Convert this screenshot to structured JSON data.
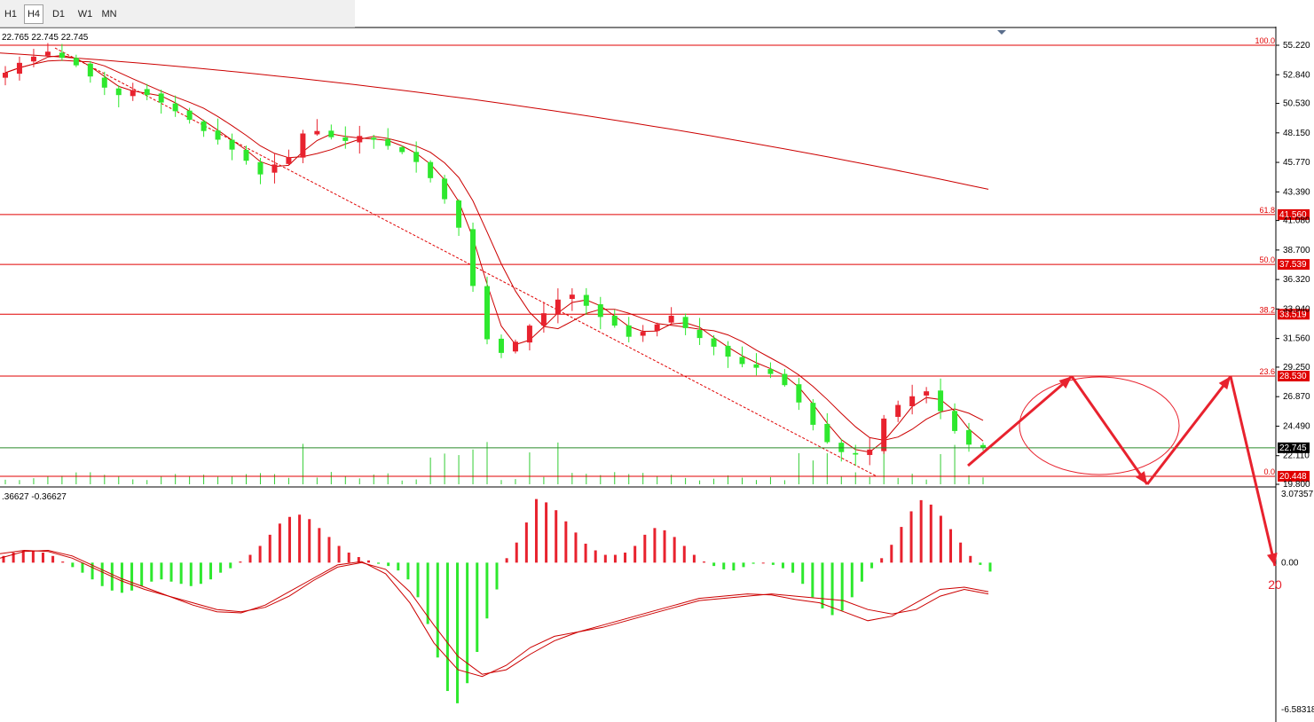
{
  "toolbar": {
    "timeframes": [
      {
        "label": "H1",
        "active": false
      },
      {
        "label": "H4",
        "active": true
      },
      {
        "label": "D1",
        "active": false
      },
      {
        "label": "W1",
        "active": false
      },
      {
        "label": "MN",
        "active": false
      }
    ]
  },
  "ohlc_text": "22.765 22.745 22.745",
  "macd_text": ".36627 -0.36627",
  "target_label": "20",
  "colors": {
    "up": "#e8222e",
    "down": "#2ee82e",
    "fib": "#e00000",
    "ma": "#cc0000",
    "current": "#2a8a2a"
  },
  "chart_data": [
    {
      "type": "candlestick",
      "title": "",
      "price_axis": {
        "ticks": [
          "55.220",
          "52.840",
          "50.530",
          "48.150",
          "45.770",
          "43.390",
          "41.080",
          "38.700",
          "36.320",
          "33.940",
          "31.560",
          "29.250",
          "26.870",
          "24.490",
          "22.110",
          "19.800"
        ],
        "ylim": [
          19.8,
          55.22
        ]
      },
      "fibonacci": [
        {
          "ratio": "100.0",
          "price": "55.220"
        },
        {
          "ratio": "61.8",
          "price": "41.560"
        },
        {
          "ratio": "50.0",
          "price": "37.539"
        },
        {
          "ratio": "38.2",
          "price": "33.519"
        },
        {
          "ratio": "23.6",
          "price": "28.530"
        },
        {
          "ratio": "0.0",
          "price": "20.448"
        }
      ],
      "current_price": "22.745",
      "close_path": [
        53.0,
        53.8,
        54.3,
        54.7,
        54.2,
        53.6,
        52.7,
        51.8,
        51.2,
        51.6,
        51.2,
        50.6,
        49.9,
        49.2,
        48.3,
        47.6,
        46.8,
        45.9,
        44.8,
        45.6,
        46.2,
        48.1,
        48.3,
        47.8,
        47.5,
        47.9,
        47.6,
        47.1,
        46.6,
        45.8,
        44.5,
        42.8,
        40.5,
        35.8,
        31.5,
        30.4,
        31.3,
        32.6,
        33.6,
        34.7,
        35.1,
        34.2,
        33.3,
        32.6,
        31.7,
        32.1,
        32.7,
        33.4,
        32.4,
        31.6,
        30.9,
        30.1,
        29.5,
        29.2,
        28.7,
        27.8,
        26.4,
        24.6,
        23.2,
        22.4,
        22.2,
        22.6,
        25.1,
        26.2,
        26.9,
        27.3,
        25.7,
        24.1,
        23.0,
        22.745
      ],
      "ma_long_start": 54.6,
      "ma_long_end": 43.6,
      "projection": [
        {
          "step": 0,
          "price": 21.3
        },
        {
          "step": 1,
          "price": 28.5
        },
        {
          "step": 2,
          "price": 19.8
        },
        {
          "step": 3,
          "price": 28.5
        },
        {
          "step": 4,
          "price": 20
        }
      ]
    },
    {
      "type": "bar",
      "title": "MACD",
      "value_axis": {
        "ticks": [
          "3.07357",
          "0.00",
          "-6.58318"
        ],
        "ylim": [
          -6.58318,
          3.07357
        ]
      },
      "histogram": [
        0.3,
        0.45,
        0.55,
        0.55,
        0.45,
        0.3,
        0.05,
        -0.2,
        -0.45,
        -0.75,
        -1.05,
        -1.25,
        -1.35,
        -1.25,
        -1.05,
        -0.85,
        -0.75,
        -0.85,
        -0.95,
        -1.05,
        -0.95,
        -0.75,
        -0.45,
        -0.25,
        0.05,
        0.35,
        0.75,
        1.25,
        1.75,
        2.05,
        2.15,
        1.95,
        1.55,
        1.15,
        0.75,
        0.45,
        0.25,
        0.1,
        -0.05,
        -0.15,
        -0.35,
        -0.75,
        -1.55,
        -2.75,
        -4.25,
        -5.75,
        -6.3,
        -5.4,
        -4.0,
        -2.5,
        -1.2,
        0.2,
        0.9,
        1.8,
        2.85,
        2.7,
        2.35,
        1.85,
        1.35,
        0.85,
        0.55,
        0.35,
        0.35,
        0.45,
        0.75,
        1.25,
        1.55,
        1.45,
        1.15,
        0.75,
        0.35,
        0.05,
        -0.15,
        -0.3,
        -0.35,
        -0.2,
        -0.05,
        0.0,
        -0.1,
        -0.25,
        -0.45,
        -0.95,
        -1.55,
        -2.05,
        -2.35,
        -2.15,
        -1.55,
        -0.85,
        -0.25,
        0.2,
        0.8,
        1.6,
        2.3,
        2.8,
        2.6,
        2.1,
        1.5,
        0.9,
        0.3,
        -0.1,
        -0.4
      ],
      "signal": [
        0.4,
        0.55,
        0.5,
        0.2,
        -0.3,
        -0.8,
        -1.2,
        -1.5,
        -1.8,
        -2.1,
        -2.2,
        -2.0,
        -1.5,
        -0.8,
        -0.2,
        0.0,
        -0.3,
        -1.3,
        -2.8,
        -4.2,
        -5.0,
        -4.8,
        -4.1,
        -3.5,
        -3.1,
        -2.9,
        -2.6,
        -2.3,
        -2.0,
        -1.7,
        -1.6,
        -1.5,
        -1.4,
        -1.5,
        -1.6,
        -1.7,
        -2.1,
        -2.3,
        -2.1,
        -1.5,
        -1.2,
        -1.4
      ],
      "macd": [
        0.2,
        0.5,
        0.55,
        0.3,
        -0.2,
        -0.7,
        -1.1,
        -1.5,
        -1.9,
        -2.2,
        -2.25,
        -1.9,
        -1.3,
        -0.7,
        -0.1,
        0.05,
        -0.5,
        -1.8,
        -3.6,
        -4.8,
        -5.1,
        -4.6,
        -3.8,
        -3.3,
        -3.1,
        -2.8,
        -2.5,
        -2.2,
        -1.9,
        -1.6,
        -1.5,
        -1.4,
        -1.45,
        -1.65,
        -1.8,
        -2.2,
        -2.6,
        -2.4,
        -1.8,
        -1.2,
        -1.1,
        -1.3
      ]
    }
  ]
}
